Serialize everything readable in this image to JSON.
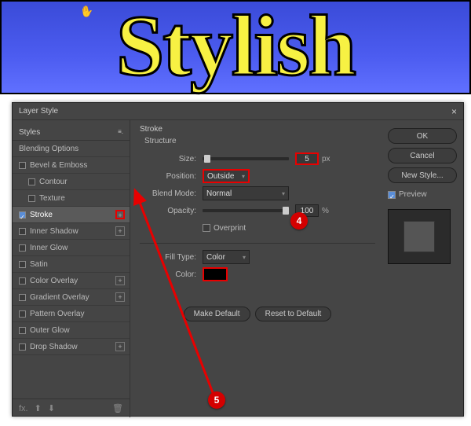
{
  "canvas": {
    "word": "Stylish"
  },
  "dialog": {
    "title": "Layer Style",
    "styles_header": "Styles",
    "menu_icon": "≡.",
    "blending_options": "Blending Options",
    "items": [
      {
        "label": "Bevel & Emboss",
        "checked": false,
        "plus": false
      },
      {
        "label": "Contour",
        "checked": false,
        "indent": true
      },
      {
        "label": "Texture",
        "checked": false,
        "indent": true
      },
      {
        "label": "Stroke",
        "checked": true,
        "plus": true,
        "selected": true
      },
      {
        "label": "Inner Shadow",
        "checked": false,
        "plus": true
      },
      {
        "label": "Inner Glow",
        "checked": false
      },
      {
        "label": "Satin",
        "checked": false
      },
      {
        "label": "Color Overlay",
        "checked": false,
        "plus": true
      },
      {
        "label": "Gradient Overlay",
        "checked": false,
        "plus": true
      },
      {
        "label": "Pattern Overlay",
        "checked": false
      },
      {
        "label": "Outer Glow",
        "checked": false
      },
      {
        "label": "Drop Shadow",
        "checked": false,
        "plus": true
      }
    ],
    "footer": {
      "fx": "fx.",
      "up": "⬆",
      "down": "⬇",
      "trash": "🗑"
    }
  },
  "stroke": {
    "title": "Stroke",
    "structure": "Structure",
    "size_label": "Size:",
    "size_value": "5",
    "size_unit": "px",
    "position_label": "Position:",
    "position_value": "Outside",
    "blend_label": "Blend Mode:",
    "blend_value": "Normal",
    "opacity_label": "Opacity:",
    "opacity_value": "100",
    "opacity_unit": "%",
    "overprint": "Overprint",
    "filltype_label": "Fill Type:",
    "filltype_value": "Color",
    "color_label": "Color:",
    "make_default": "Make Default",
    "reset_default": "Reset to Default"
  },
  "right": {
    "ok": "OK",
    "cancel": "Cancel",
    "new_style": "New Style...",
    "preview": "Preview"
  },
  "annotations": {
    "badge4": "4",
    "badge5": "5"
  }
}
